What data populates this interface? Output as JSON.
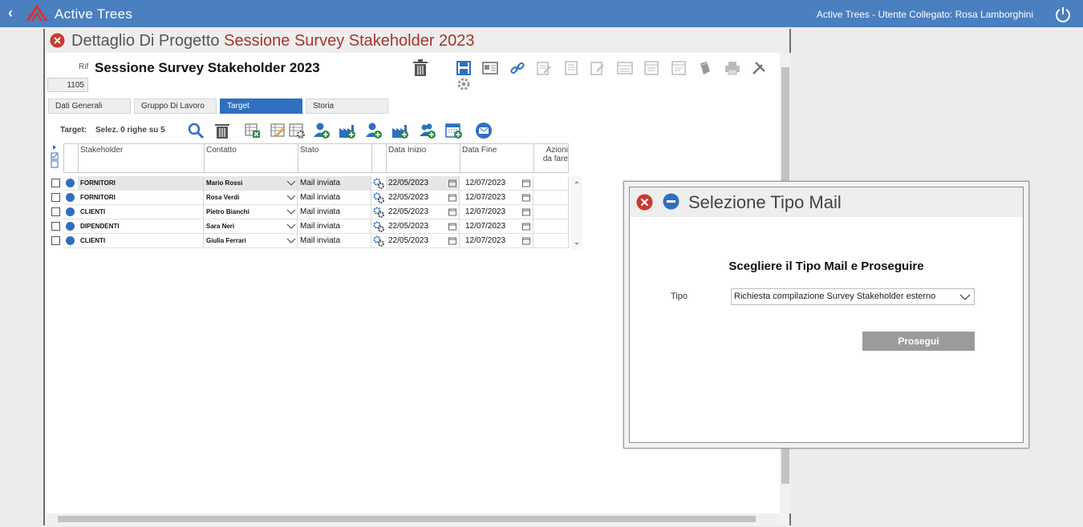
{
  "topbar": {
    "app_title": "Active Trees",
    "user_info": "Active Trees - Utente Collegato: Rosa Lamborghini"
  },
  "panel": {
    "title_prefix": "Dettaglio Di Progetto",
    "title_project": "Sessione Survey Stakeholder 2023",
    "rif_label": "Rif",
    "project_name": "Sessione Survey Stakeholder 2023",
    "project_id": "1105",
    "tabs": [
      {
        "label": "Dati Generali"
      },
      {
        "label": "Gruppo Di Lavoro"
      },
      {
        "label": "Target"
      },
      {
        "label": "Storia"
      }
    ],
    "target_label": "Target:",
    "selection_text": "Selez. 0 righe su 5"
  },
  "grid": {
    "columns": [
      "Stakeholder",
      "Contatto",
      "Stato",
      "Data Inizio",
      "Data Fine",
      "Azioni da fare"
    ],
    "rows": [
      {
        "stakeholder": "FORNITORI",
        "contatto": "Mario Rossi",
        "stato": "Mail inviata",
        "data_inizio": "22/05/2023",
        "data_fine": "12/07/2023"
      },
      {
        "stakeholder": "FORNITORI",
        "contatto": "Rosa Verdi",
        "stato": "Mail inviata",
        "data_inizio": "22/05/2023",
        "data_fine": "12/07/2023"
      },
      {
        "stakeholder": "CLIENTI",
        "contatto": "Pietro Bianchi",
        "stato": "Mail inviata",
        "data_inizio": "22/05/2023",
        "data_fine": "12/07/2023"
      },
      {
        "stakeholder": "DIPENDENTI",
        "contatto": "Sara Neri",
        "stato": "Mail inviata",
        "data_inizio": "22/05/2023",
        "data_fine": "12/07/2023"
      },
      {
        "stakeholder": "CLIENTI",
        "contatto": "Giulia Ferrari",
        "stato": "Mail inviata",
        "data_inizio": "22/05/2023",
        "data_fine": "12/07/2023"
      }
    ]
  },
  "dialog": {
    "title": "Selezione Tipo Mail",
    "message": "Scegliere il Tipo Mail e Proseguire",
    "tipo_label": "Tipo",
    "tipo_value": "Richiesta compilazione Survey Stakeholder esterno",
    "proceed_label": "Prosegui"
  }
}
